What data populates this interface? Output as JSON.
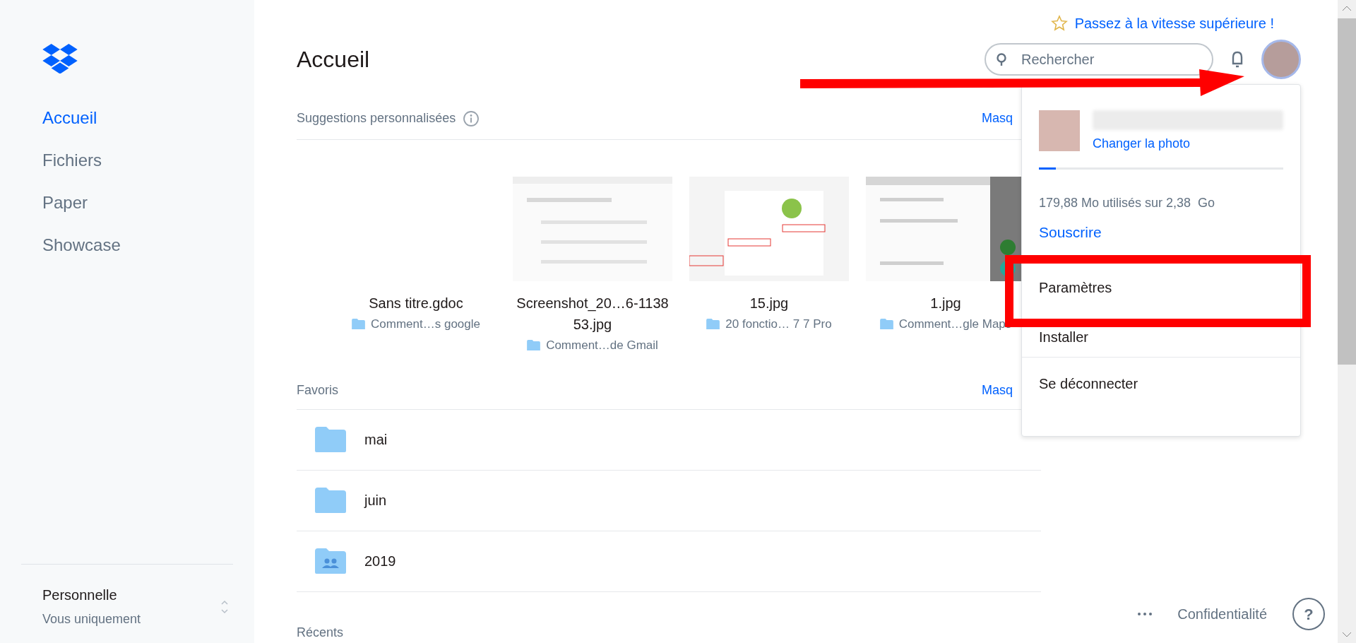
{
  "sidebar": {
    "items": [
      {
        "label": "Accueil",
        "selected": true
      },
      {
        "label": "Fichiers",
        "selected": false
      },
      {
        "label": "Paper",
        "selected": false
      },
      {
        "label": "Showcase",
        "selected": false
      }
    ],
    "account": {
      "name": "Personnelle",
      "subtitle": "Vous uniquement"
    }
  },
  "header": {
    "upgrade_link": "Passez à la vitesse supérieure !",
    "title": "Accueil",
    "search": {
      "placeholder": "Rechercher"
    }
  },
  "suggestions": {
    "title": "Suggestions personnalisées",
    "hide_link": "Masq",
    "items": [
      {
        "name": "Sans titre.gdoc",
        "folder": "Comment…s google",
        "kind": "blank"
      },
      {
        "name": "Screenshot_20…6-113853.jpg",
        "folder": "Comment…de Gmail",
        "kind": "picture"
      },
      {
        "name": "15.jpg",
        "folder": "20 fonctio… 7 7 Pro",
        "kind": "picture"
      },
      {
        "name": "1.jpg",
        "folder": "Comment…gle Maps",
        "kind": "picture"
      }
    ]
  },
  "favorites": {
    "title": "Favoris",
    "hide_link": "Masq",
    "items": [
      {
        "name": "mai",
        "kind": "folder"
      },
      {
        "name": "juin",
        "kind": "folder"
      },
      {
        "name": "2019",
        "kind": "shared"
      }
    ]
  },
  "recent": {
    "title": "Récents"
  },
  "account_menu": {
    "change_photo": "Changer la photo",
    "storage": {
      "level": 0.07,
      "text": "179,88 Mo utilisés sur 2,38  Go"
    },
    "subscribe": "Souscrire",
    "items": [
      "Paramètres",
      "Installer"
    ],
    "sign_out": "Se déconnecter"
  },
  "footer": {
    "privacy": "Confidentialité",
    "help": "?"
  }
}
